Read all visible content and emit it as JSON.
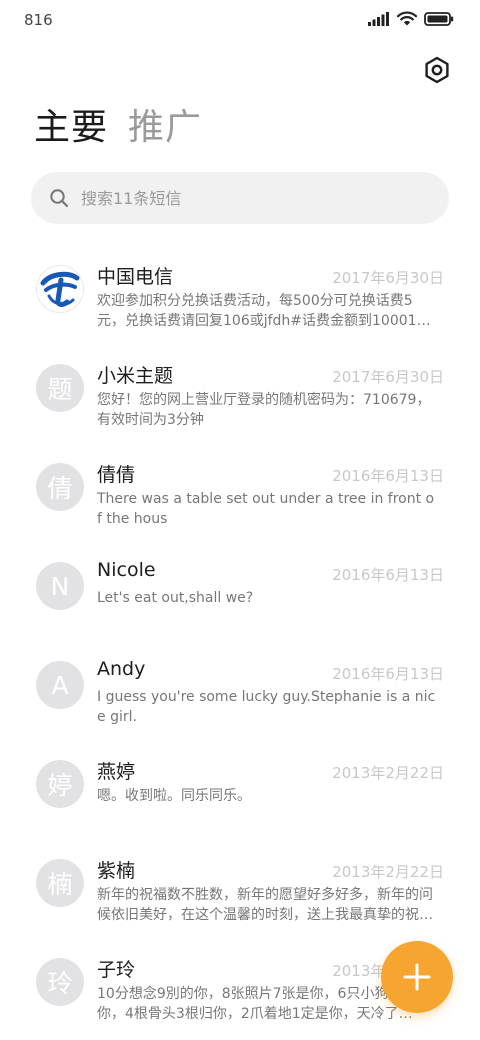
{
  "status_bar": {
    "time": "816",
    "icons": [
      "signal-icon",
      "wifi-icon",
      "battery-icon"
    ]
  },
  "header": {
    "settings_icon": "settings-icon",
    "tabs": [
      {
        "label": "主要",
        "active": true
      },
      {
        "label": "推广",
        "active": false
      }
    ]
  },
  "search": {
    "placeholder": "搜索11条短信"
  },
  "messages": [
    {
      "name": "中国电信",
      "date": "2017年6月30日",
      "preview": "欢迎参加积分兑换话费活动，每500分可兑换话费5元，兑换话费请回复106或jfdh#话费金额到10001。回复…",
      "avatar": "telecom-logo"
    },
    {
      "name": "小米主题",
      "date": "2017年6月30日",
      "preview": "您好！您的网上营业厅登录的随机密码为：710679，有效时间为3分钟",
      "avatar": "题"
    },
    {
      "name": "倩倩",
      "date": "2016年6月13日",
      "preview": "There was a table set out under a tree in front of the hous",
      "avatar": "倩"
    },
    {
      "name": "Nicole",
      "date": "2016年6月13日",
      "preview": "Let's eat out,shall we?",
      "avatar": "N"
    },
    {
      "name": "Andy",
      "date": "2016年6月13日",
      "preview": "I guess you're some lucky guy.Stephanie is a nice girl.",
      "avatar": "A"
    },
    {
      "name": "燕婷",
      "date": "2013年2月22日",
      "preview": "嗯。收到啦。同乐同乐。",
      "avatar": "婷"
    },
    {
      "name": "紫楠",
      "date": "2013年2月22日",
      "preview": "新年的祝福数不胜数，新年的愿望好多好多，新年的问候依旧美好，在这个温馨的时刻，送上我最真挚的祝福，…",
      "avatar": "楠"
    },
    {
      "name": "子玲",
      "date": "2013年2月22日",
      "preview": "10分想念9別的你，8张照片7张是你，6只小狗5只像你，4根骨头3根归你，2爪着地1定是你，天冷了…",
      "avatar": "玲"
    }
  ],
  "fab": {
    "icon": "plus-icon",
    "color": "#f6a531"
  },
  "colors": {
    "avatar_bg": "#e2e2e4",
    "search_bg": "#f1f1f1",
    "telecom_blue": "#1a58b5"
  }
}
